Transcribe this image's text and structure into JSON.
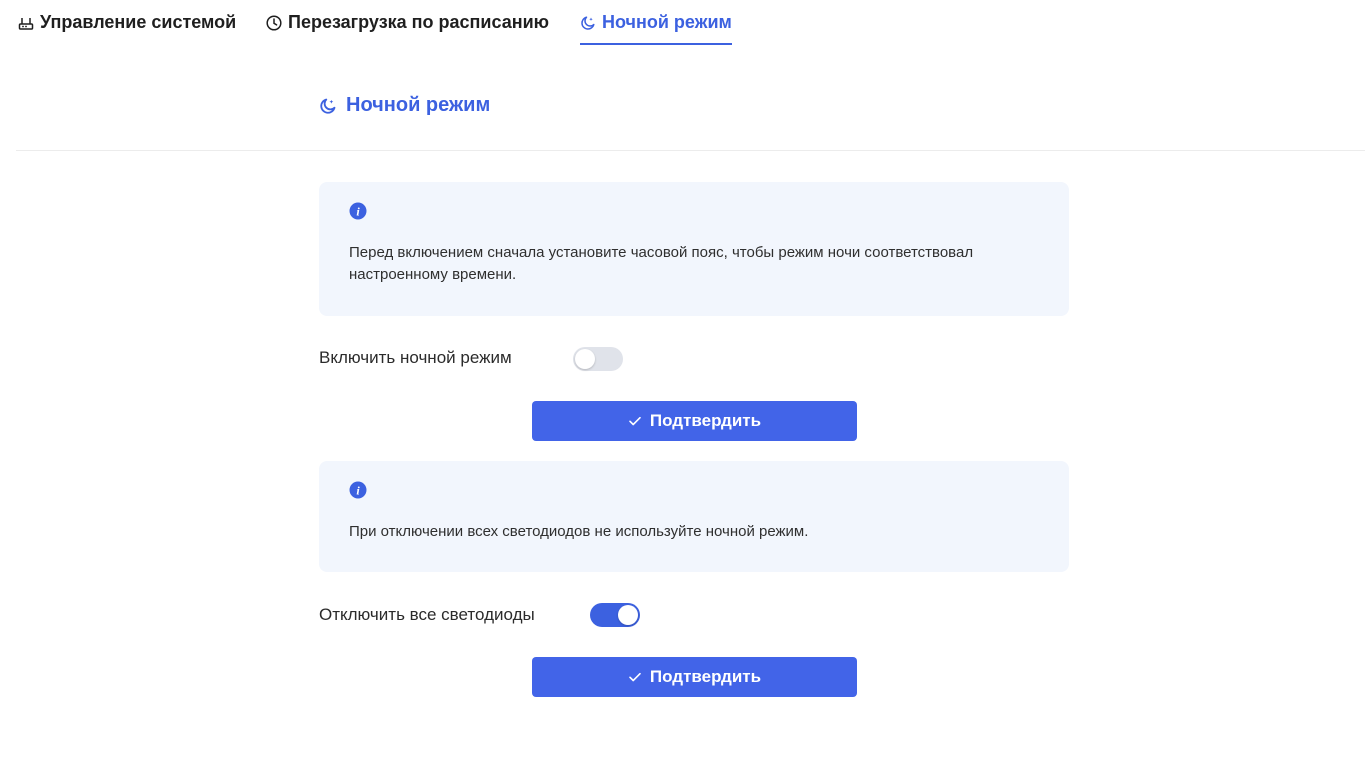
{
  "tabs": [
    {
      "label": "Управление системой",
      "icon": "router-icon",
      "active": false
    },
    {
      "label": "Перезагрузка по расписанию",
      "icon": "clock-icon",
      "active": false
    },
    {
      "label": "Ночной режим",
      "icon": "moon-icon",
      "active": true
    }
  ],
  "section": {
    "title": "Ночной режим",
    "icon": "moon-icon"
  },
  "night_mode": {
    "info_icon": "info-icon",
    "info_text": "Перед включением сначала установите часовой пояс, чтобы режим ночи соответствовал настроенному времени.",
    "toggle_label": "Включить ночной режим",
    "toggle_on": false,
    "confirm_label": "Подтвердить"
  },
  "leds": {
    "info_icon": "info-icon",
    "info_text": "При отключении всех светодиодов не используйте ночной режим.",
    "toggle_label": "Отключить все светодиоды",
    "toggle_on": true,
    "confirm_label": "Подтвердить"
  },
  "colors": {
    "accent": "#3c61e0",
    "button": "#4264e8",
    "info_bg": "#f2f6fd",
    "switch_off": "#e0e3ea"
  }
}
